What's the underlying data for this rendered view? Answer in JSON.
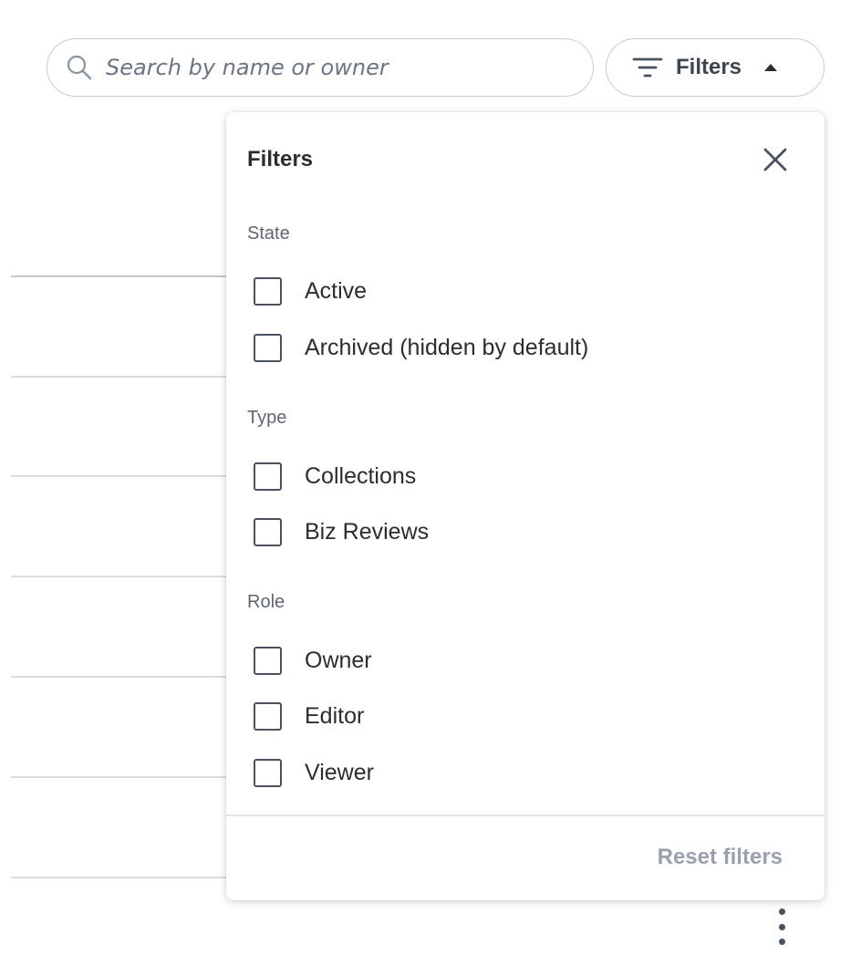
{
  "search": {
    "placeholder": "Search by name or owner",
    "value": "",
    "icon": "search-icon"
  },
  "filter_toggle": {
    "label": "Filters",
    "icon": "filter-lines-icon",
    "caret": "caret-up-icon"
  },
  "popover": {
    "title": "Filters",
    "close_icon": "close-icon",
    "sections": [
      {
        "label": "State",
        "options": [
          {
            "label": "Active",
            "checked": false
          },
          {
            "label": "Archived (hidden by default)",
            "checked": false
          }
        ]
      },
      {
        "label": "Type",
        "options": [
          {
            "label": "Collections",
            "checked": false
          },
          {
            "label": "Biz Reviews",
            "checked": false
          }
        ]
      },
      {
        "label": "Role",
        "options": [
          {
            "label": "Owner",
            "checked": false
          },
          {
            "label": "Editor",
            "checked": false
          },
          {
            "label": "Viewer",
            "checked": false
          }
        ]
      }
    ],
    "reset_label": "Reset filters"
  },
  "row_menu_icon": "more-vertical-icon",
  "colors": {
    "text": "#2b2d31",
    "muted": "#6b7585",
    "border": "#c8ccd2",
    "reset": "#9aa1ad"
  }
}
